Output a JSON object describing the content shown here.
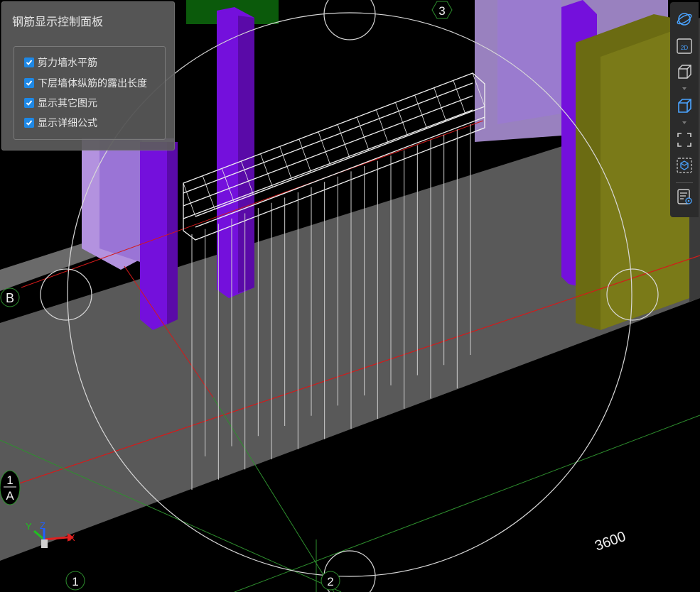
{
  "panel": {
    "title": "钢筋显示控制面板",
    "options": [
      {
        "label": "剪力墙水平筋",
        "checked": true
      },
      {
        "label": "下层墙体纵筋的露出长度",
        "checked": true
      },
      {
        "label": "显示其它图元",
        "checked": true
      },
      {
        "label": "显示详细公式",
        "checked": true
      }
    ]
  },
  "viewport": {
    "grid_labels": {
      "axis_3": "3",
      "axis_B": "B",
      "axis_1A_top": "1",
      "axis_1A_bottom": "A",
      "axis_1": "1",
      "axis_2": "2"
    },
    "dimension_text": "3600",
    "axes": {
      "x": "X",
      "y": "Y",
      "z": "Z"
    }
  },
  "toolbar": {
    "buttons": [
      "orbit-icon",
      "view-2d-icon",
      "view-3d-icon",
      "view-3d-active-icon",
      "fit-view-icon",
      "select-box-icon",
      "properties-icon"
    ],
    "label_2d": "2D"
  },
  "colors": {
    "background": "#000000",
    "floor": "#5a5a5a",
    "column_purple": "#7a12e0",
    "wall_lavender": "#b08ee0",
    "wall_olive": "#6b6b10",
    "grid_red": "#d01818",
    "grid_green": "#2a8c2a",
    "rebar_white": "#e0e0e0",
    "checkbox_blue": "#1e88e5",
    "panel_bg": "#5c5c5c"
  }
}
